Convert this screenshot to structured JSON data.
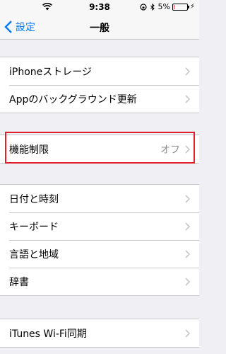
{
  "status": {
    "time": "9:38",
    "battery": "5%"
  },
  "nav": {
    "back_label": "設定",
    "title": "一般"
  },
  "group1": [
    "iPhoneストレージ",
    "Appのバックグラウンド更新"
  ],
  "restrictions": {
    "label": "機能制限",
    "value": "オフ"
  },
  "group3": [
    "日付と時刻",
    "キーボード",
    "言語と地域",
    "辞書"
  ],
  "group4": [
    "iTunes Wi-Fi同期"
  ],
  "colors": {
    "accent": "#007aff",
    "highlight": "#e0202a",
    "background": "#efeff4"
  }
}
